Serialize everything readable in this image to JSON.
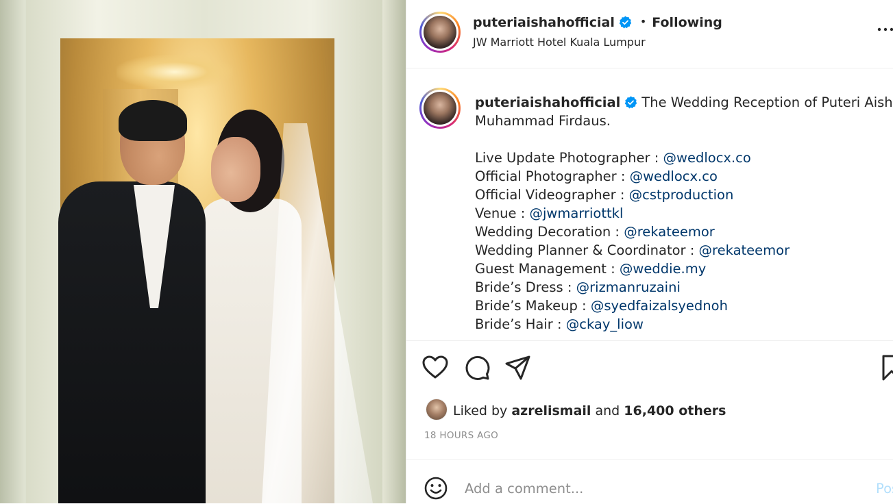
{
  "post": {
    "username": "puteriaishahofficial",
    "location": "JW Marriott Hotel Kuala Lumpur",
    "follow_separator": "•",
    "follow_status": "Following"
  },
  "caption": {
    "username": "puteriaishahofficial",
    "title_line1": "The Wedding Reception of Puteri Aishah &",
    "title_line2": "Muhammad Firdaus.",
    "credits": [
      {
        "label": "Live Update Photographer : ",
        "mention": "@wedlocx.co"
      },
      {
        "label": "Official Photographer : ",
        "mention": "@wedlocx.co"
      },
      {
        "label": "Official Videographer : ",
        "mention": "@cstproduction"
      },
      {
        "label": "Venue : ",
        "mention": "@jwmarriottkl"
      },
      {
        "label": "Wedding Decoration : ",
        "mention": "@rekateemor"
      },
      {
        "label": "Wedding Planner & Coordinator : ",
        "mention": "@rekateemor"
      },
      {
        "label": "Guest Management : ",
        "mention": "@weddie.my"
      },
      {
        "label": "Bride’s Dress : ",
        "mention": "@rizmanruzaini"
      },
      {
        "label": "Bride’s Makeup : ",
        "mention": "@syedfaizalsyednoh"
      },
      {
        "label": "Bride’s Hair : ",
        "mention": "@ckay_liow"
      }
    ]
  },
  "likes": {
    "prefix": "Liked by ",
    "user": "azrelismail",
    "middle": " and ",
    "others": "16,400 others"
  },
  "timestamp": "18 HOURS AGO",
  "comment": {
    "placeholder": "Add a comment...",
    "post_label": "Post"
  },
  "icons": {
    "like": "heart-icon",
    "comment": "comment-bubble-icon",
    "share": "paper-plane-icon",
    "save": "bookmark-icon",
    "emoji": "smiley-icon",
    "more": "more-dots-icon",
    "verified": "verified-badge-icon"
  },
  "colors": {
    "text": "#262626",
    "mention": "#00376b",
    "muted": "#8e8e8e",
    "verified": "#0095f6",
    "post_disabled": "#b2dffc"
  }
}
